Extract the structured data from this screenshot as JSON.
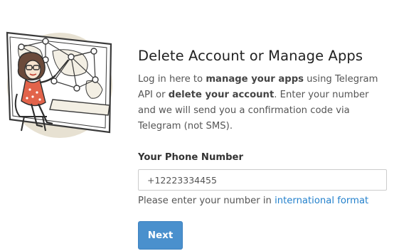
{
  "title": "Delete Account or Manage Apps",
  "description": {
    "part1": "Log in here to ",
    "bold1": "manage your apps",
    "part2": " using Telegram API or ",
    "bold2": "delete your account",
    "part3": ". Enter your number and we will send you a confirmation code via Telegram (not SMS)."
  },
  "phone": {
    "label": "Your Phone Number",
    "value": "+12223334455"
  },
  "hint": {
    "text": "Please enter your number in ",
    "link": "international format"
  },
  "next_label": "Next",
  "colors": {
    "accent": "#2481cc",
    "button": "#4a90cd",
    "illustration_bg": "#e7e1d2"
  },
  "illustration": {
    "icon": "woman-at-world-map-illustration"
  }
}
